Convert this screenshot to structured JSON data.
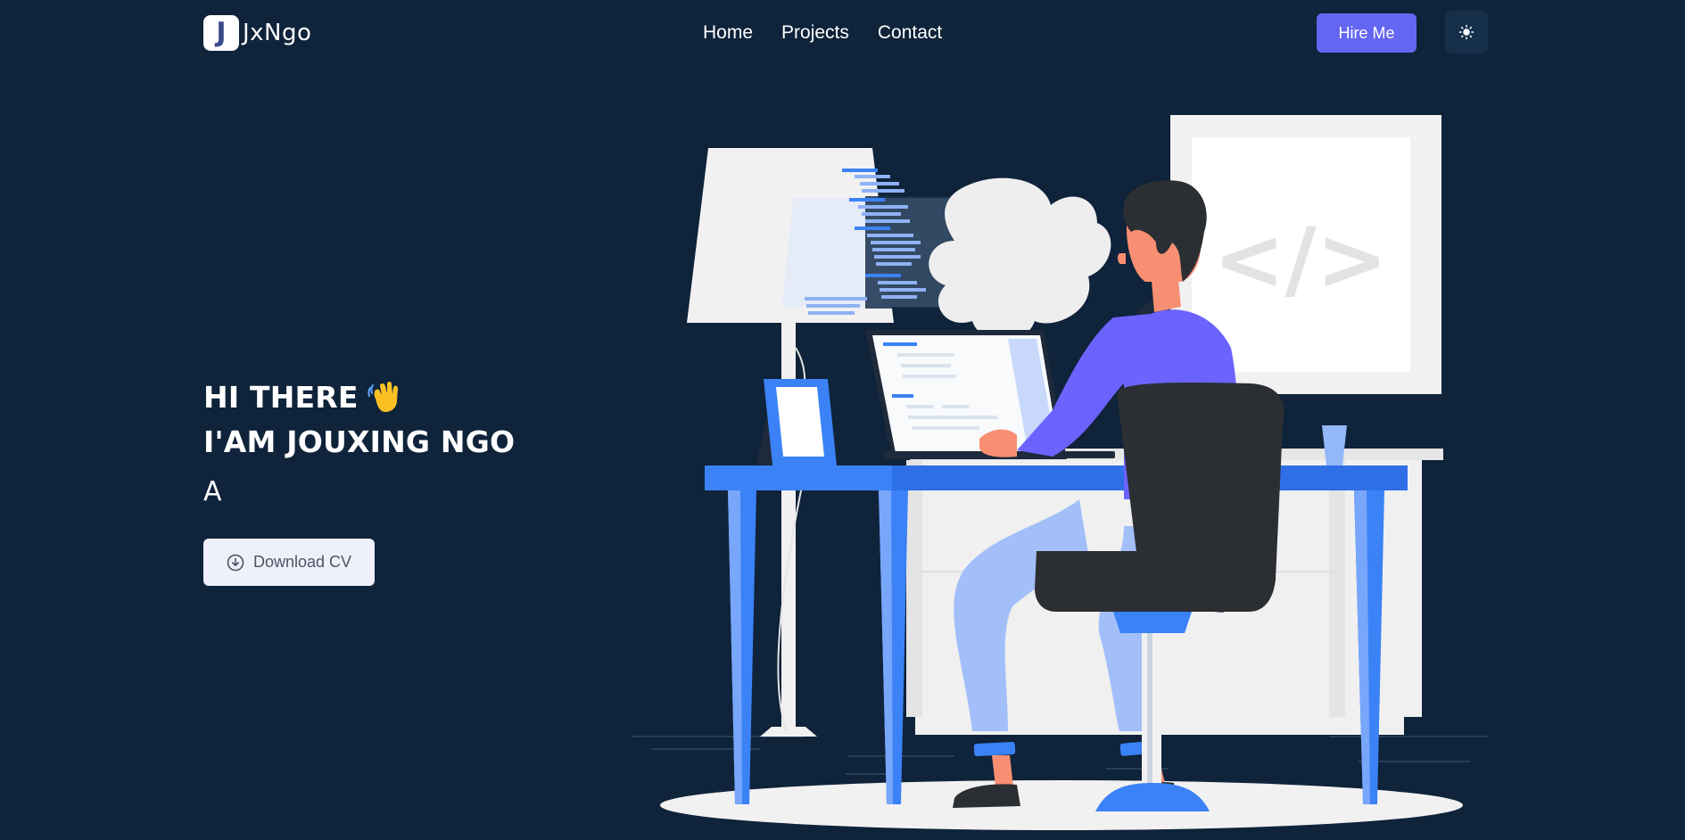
{
  "brand": {
    "badge_letter": "J",
    "name": "JxNgo"
  },
  "nav": {
    "items": [
      {
        "label": "Home"
      },
      {
        "label": "Projects"
      },
      {
        "label": "Contact"
      }
    ]
  },
  "header": {
    "hire_label": "Hire Me",
    "theme_icon": "sun-icon"
  },
  "hero": {
    "greeting": "HI THERE",
    "greeting_emoji_icon": "waving-hand-icon",
    "headline": "I'AM JOUXING NGO",
    "role_text": "A",
    "cv_label": "Download CV",
    "cv_icon": "download-circle-icon"
  },
  "illustration": {
    "icon": "developer-at-desk-illustration",
    "code_symbol": "</>"
  },
  "colors": {
    "background": "#0f233a",
    "accent": "#6366f1",
    "desk_blue": "#3b82f6",
    "button_light": "#eef1fb"
  }
}
